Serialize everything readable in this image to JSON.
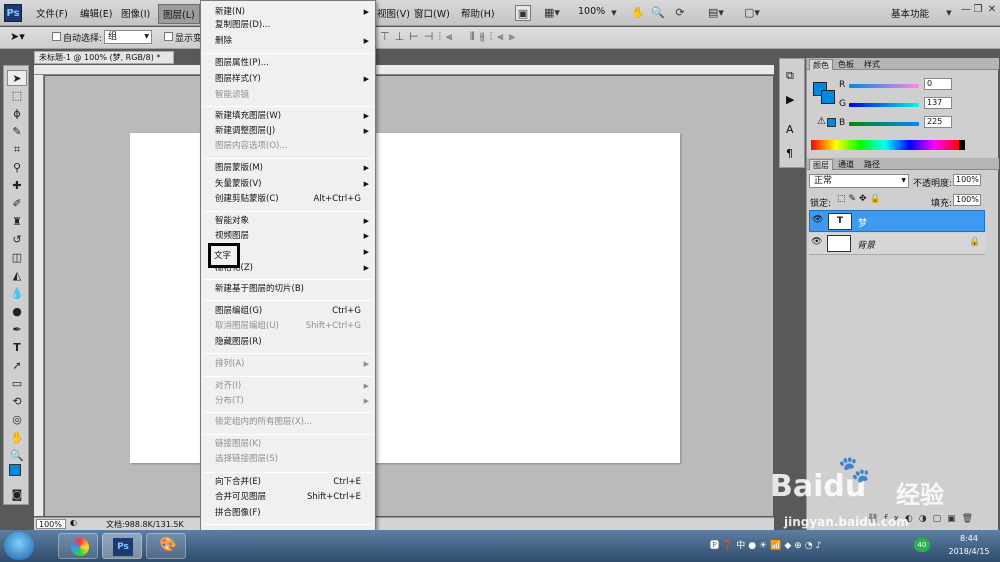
{
  "app": {
    "logo": "Ps"
  },
  "menubar": {
    "items": [
      "文件(F)",
      "编辑(E)",
      "图像(I)",
      "图层(L)",
      "视图(V)",
      "窗口(W)",
      "帮助(H)"
    ],
    "zoom": "100%",
    "workspace": "基本功能"
  },
  "options": {
    "auto_select_label": "自动选择:",
    "auto_select_value": "组",
    "show_label": "显示变"
  },
  "document": {
    "tab": "未标题-1 @ 100% (梦, RGB/8) *",
    "zoom": "100%",
    "status": "文档:988.8K/131.5K"
  },
  "menu": {
    "items": [
      {
        "label": "新建(N)",
        "sub": true
      },
      {
        "label": "复制图层(D)..."
      },
      {
        "label": "删除",
        "sub": true
      },
      {
        "label": "图层属性(P)..."
      },
      {
        "label": "图层样式(Y)",
        "sub": true
      },
      {
        "label": "智能滤镜",
        "dis": true
      },
      {
        "label": "新建填充图层(W)",
        "sub": true
      },
      {
        "label": "新建调整图层(J)",
        "sub": true
      },
      {
        "label": "图层内容选项(O)...",
        "dis": true
      },
      {
        "label": "图层蒙版(M)",
        "sub": true
      },
      {
        "label": "矢量蒙版(V)",
        "sub": true
      },
      {
        "label": "创建剪贴蒙版(C)",
        "sc": "Alt+Ctrl+G"
      },
      {
        "label": "智能对象",
        "sub": true
      },
      {
        "label": "视频图层",
        "sub": true
      },
      {
        "label": "文字",
        "sub": true
      },
      {
        "label": "栅格化(Z)",
        "sub": true
      },
      {
        "label": "新建基于图层的切片(B)"
      },
      {
        "label": "图层编组(G)",
        "sc": "Ctrl+G"
      },
      {
        "label": "取消图层编组(U)",
        "sc": "Shift+Ctrl+G",
        "dis": true
      },
      {
        "label": "隐藏图层(R)"
      },
      {
        "label": "排列(A)",
        "sub": true,
        "dis": true
      },
      {
        "label": "对齐(I)",
        "sub": true,
        "dis": true
      },
      {
        "label": "分布(T)",
        "sub": true,
        "dis": true
      },
      {
        "label": "锁定组内的所有图层(X)...",
        "dis": true
      },
      {
        "label": "链接图层(K)",
        "dis": true
      },
      {
        "label": "选择链接图层(S)",
        "dis": true
      },
      {
        "label": "向下合并(E)",
        "sc": "Ctrl+E"
      },
      {
        "label": "合并可见图层",
        "sc": "Shift+Ctrl+E"
      },
      {
        "label": "拼合图像(F)"
      },
      {
        "label": "修边",
        "sub": true,
        "dis": true
      }
    ]
  },
  "color_panel": {
    "tabs": [
      "颜色",
      "色板",
      "样式"
    ],
    "r": "0",
    "g": "137",
    "b": "225",
    "fg_color": "#0089e1",
    "bg_color": "#0089e1"
  },
  "layers_panel": {
    "tabs": [
      "图层",
      "通道",
      "路径"
    ],
    "blend_mode": "正常",
    "opacity_label": "不透明度:",
    "opacity": "100%",
    "lock_label": "锁定:",
    "fill_label": "填充:",
    "fill": "100%",
    "layers": [
      {
        "name": "梦",
        "type": "text",
        "selected": true
      },
      {
        "name": "背景",
        "type": "background",
        "locked": true
      }
    ]
  },
  "taskbar": {
    "time": "8:44",
    "date": "2018/4/15",
    "tray_badge": "40"
  },
  "watermark": {
    "brand": "Baidu",
    "cn": "经验",
    "url": "jingyan.baidu.com"
  }
}
